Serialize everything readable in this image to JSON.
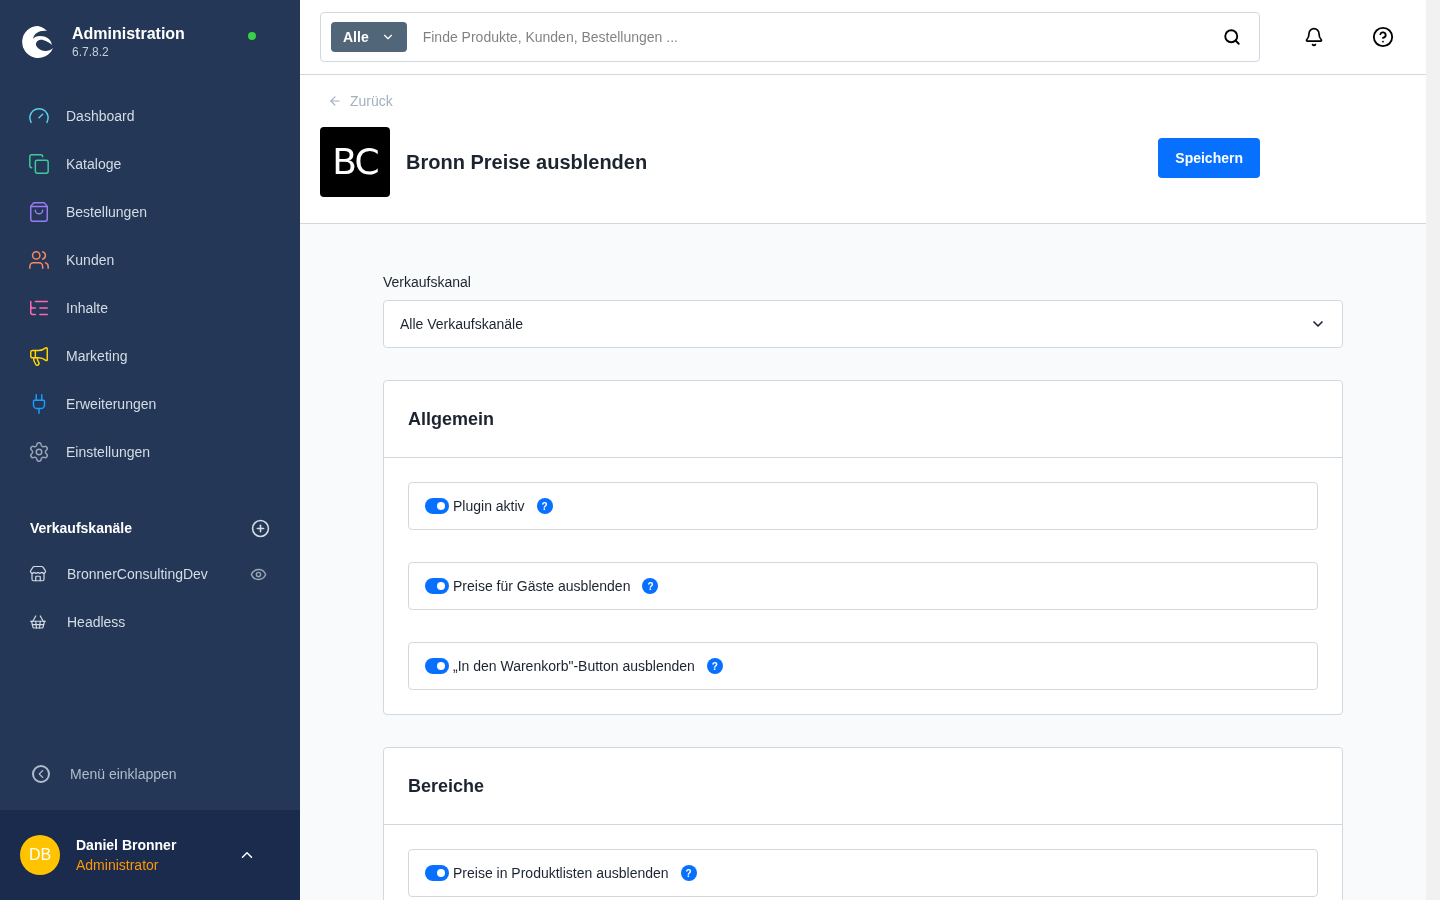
{
  "brand": {
    "title": "Administration",
    "version": "6.7.8.2",
    "online": true
  },
  "nav": [
    {
      "kind": "dashboard",
      "label": "Dashboard"
    },
    {
      "kind": "catalog",
      "label": "Kataloge"
    },
    {
      "kind": "orders",
      "label": "Bestellungen"
    },
    {
      "kind": "customers",
      "label": "Kunden"
    },
    {
      "kind": "content",
      "label": "Inhalte"
    },
    {
      "kind": "marketing",
      "label": "Marketing"
    },
    {
      "kind": "extensions",
      "label": "Erweiterungen"
    },
    {
      "kind": "settings",
      "label": "Einstellungen"
    }
  ],
  "sales_channels": {
    "title": "Verkaufskanäle",
    "items": [
      {
        "kind": "storefront",
        "label": "BronnerConsultingDev",
        "preview": true
      },
      {
        "kind": "headless",
        "label": "Headless",
        "preview": false
      }
    ]
  },
  "collapse": "Menü einklappen",
  "user": {
    "initials": "DB",
    "name": "Daniel Bronner",
    "role": "Administrator"
  },
  "search": {
    "scope": "Alle",
    "placeholder": "Finde Produkte, Kunden, Bestellungen ..."
  },
  "back": "Zurück",
  "plugin": {
    "logo": "BC",
    "title": "Bronn Preise ausblenden",
    "save": "Speichern"
  },
  "channel_select": {
    "label": "Verkaufskanal",
    "value": "Alle Verkaufskanäle"
  },
  "cards": [
    {
      "title": "Allgemein",
      "settings": [
        {
          "label": "Plugin aktiv",
          "on": true,
          "help": "?"
        },
        {
          "label": "Preise für Gäste ausblenden",
          "on": true,
          "help": "?"
        },
        {
          "label": "„In den Warenkorb\"-Button ausblenden",
          "on": true,
          "help": "?"
        }
      ]
    },
    {
      "title": "Bereiche",
      "settings": [
        {
          "label": "Preise in Produktlisten ausblenden",
          "on": true,
          "help": "?"
        }
      ]
    }
  ]
}
